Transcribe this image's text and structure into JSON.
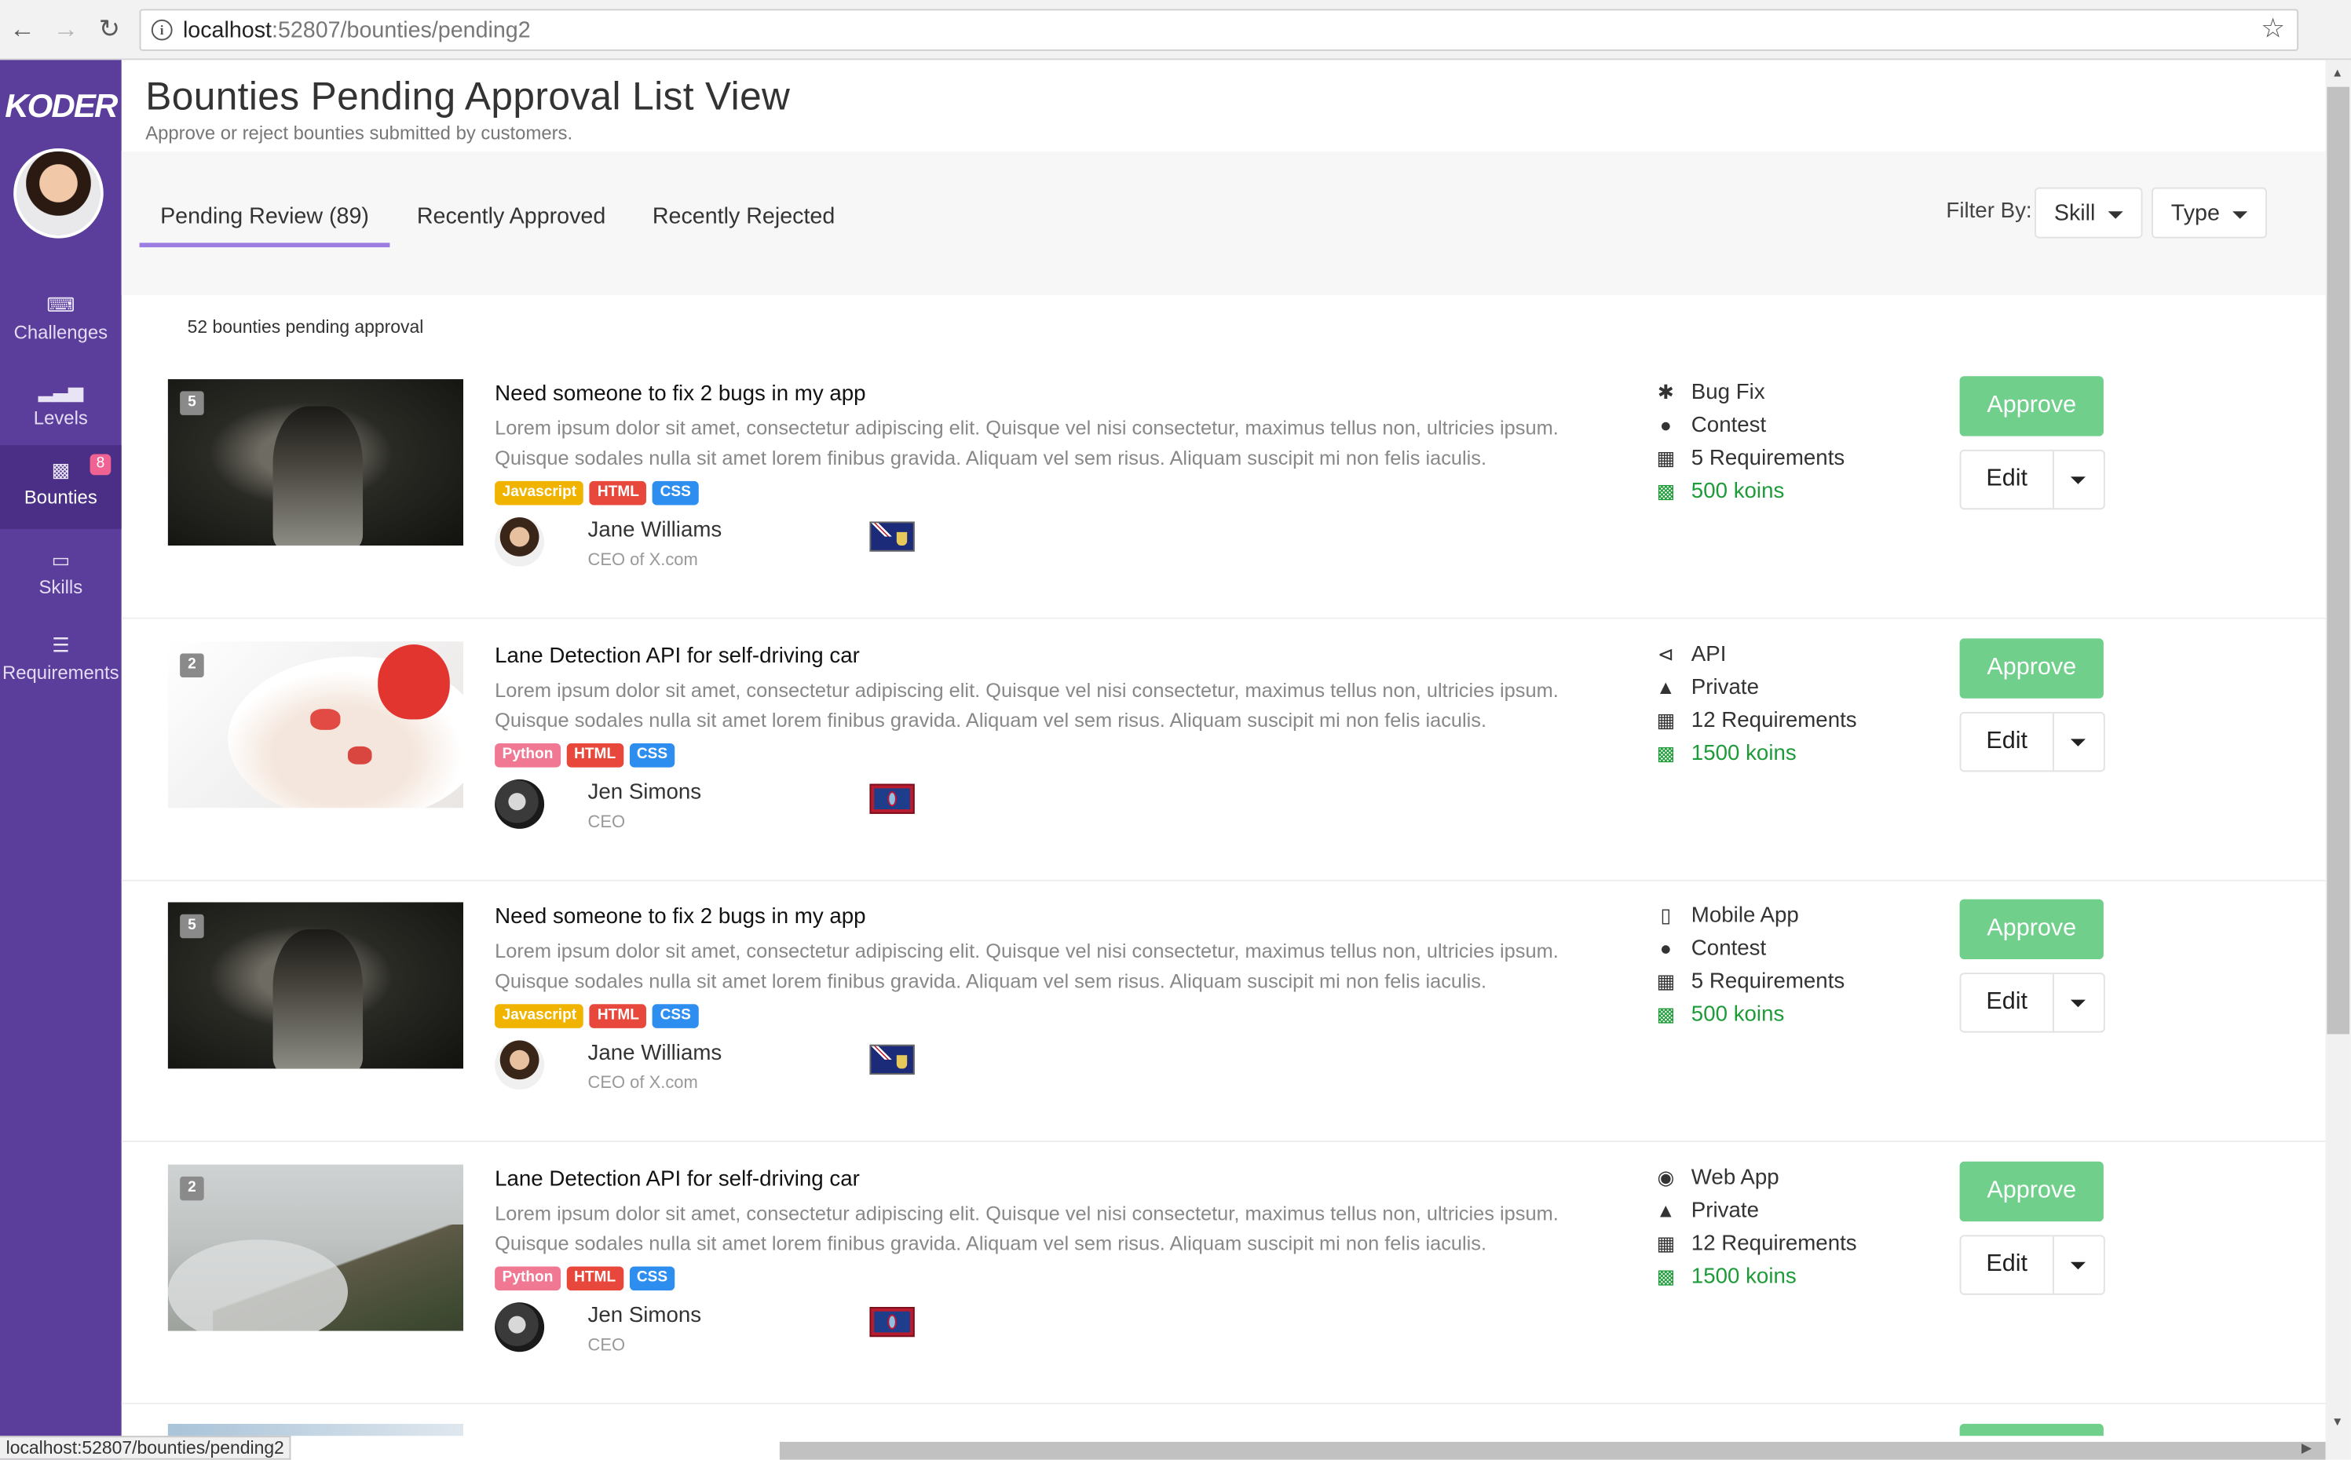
{
  "browser": {
    "url_host": "localhost",
    "url_path": ":52807/bounties/pending2"
  },
  "sidebar": {
    "logo": "KODER",
    "items": [
      {
        "label": "Challenges",
        "icon": "keyboard-icon"
      },
      {
        "label": "Levels",
        "icon": "signal-icon"
      },
      {
        "label": "Bounties",
        "icon": "money-icon",
        "badge": "8"
      },
      {
        "label": "Skills",
        "icon": "laptop-icon"
      },
      {
        "label": "Requirements",
        "icon": "list-icon"
      }
    ]
  },
  "header": {
    "title": "Bounties Pending Approval List View",
    "subtitle": "Approve or reject bounties submitted by customers."
  },
  "tabs": [
    "Pending Review (89)",
    "Recently Approved",
    "Recently Rejected"
  ],
  "filters": {
    "label": "Filter By:",
    "skill": "Skill",
    "type": "Type"
  },
  "count_text": "52 bounties pending approval",
  "colors": {
    "sidebar": "#5b3d9b",
    "approve": "#6fcf8b",
    "tab_underline": "#9c7ee3",
    "koins": "#1e9b39",
    "tag_javascript": "#f0b400",
    "tag_html": "#e8473b",
    "tag_css": "#2d8ef0",
    "tag_python": "#f07893"
  },
  "bounties": [
    {
      "badge": "5",
      "title": "Need someone to fix 2 bugs in my app",
      "desc1": "Lorem ipsum dolor sit amet, consectetur adipiscing elit. Quisque vel nisi consectetur, maximus tellus non, ultricies ipsum.",
      "desc2": "Quisque sodales nulla sit amet lorem finibus gravida. Aliquam vel sem risus. Aliquam suscipit mi non felis iaculis.",
      "tags": [
        "Javascript",
        "HTML",
        "CSS"
      ],
      "person": "Jane Williams",
      "role": "CEO of X.com",
      "meta": [
        "Bug Fix",
        "Contest",
        "5 Requirements",
        "500 koins"
      ],
      "meta_icons": [
        "bug-icon",
        "users-icon",
        "calendar-icon",
        "money-icon"
      ],
      "approve": "Approve",
      "edit": "Edit"
    },
    {
      "badge": "2",
      "title": "Lane Detection API for self-driving car",
      "desc1": "Lorem ipsum dolor sit amet, consectetur adipiscing elit. Quisque vel nisi consectetur, maximus tellus non, ultricies ipsum.",
      "desc2": "Quisque sodales nulla sit amet lorem finibus gravida. Aliquam vel sem risus. Aliquam suscipit mi non felis iaculis.",
      "tags": [
        "Python",
        "HTML",
        "CSS"
      ],
      "person": "Jen Simons",
      "role": "CEO",
      "meta": [
        "API",
        "Private",
        "12 Requirements",
        "1500 koins"
      ],
      "meta_icons": [
        "share-icon",
        "trophy-icon",
        "calendar-icon",
        "money-icon"
      ],
      "approve": "Approve",
      "edit": "Edit"
    },
    {
      "badge": "5",
      "title": "Need someone to fix 2 bugs in my app",
      "desc1": "Lorem ipsum dolor sit amet, consectetur adipiscing elit. Quisque vel nisi consectetur, maximus tellus non, ultricies ipsum.",
      "desc2": "Quisque sodales nulla sit amet lorem finibus gravida. Aliquam vel sem risus. Aliquam suscipit mi non felis iaculis.",
      "tags": [
        "Javascript",
        "HTML",
        "CSS"
      ],
      "person": "Jane Williams",
      "role": "CEO of X.com",
      "meta": [
        "Mobile App",
        "Contest",
        "5 Requirements",
        "500 koins"
      ],
      "meta_icons": [
        "mobile-icon",
        "users-icon",
        "calendar-icon",
        "money-icon"
      ],
      "approve": "Approve",
      "edit": "Edit"
    },
    {
      "badge": "2",
      "title": "Lane Detection API for self-driving car",
      "desc1": "Lorem ipsum dolor sit amet, consectetur adipiscing elit. Quisque vel nisi consectetur, maximus tellus non, ultricies ipsum.",
      "desc2": "Quisque sodales nulla sit amet lorem finibus gravida. Aliquam vel sem risus. Aliquam suscipit mi non felis iaculis.",
      "tags": [
        "Python",
        "HTML",
        "CSS"
      ],
      "person": "Jen Simons",
      "role": "CEO",
      "meta": [
        "Web App",
        "Private",
        "12 Requirements",
        "1500 koins"
      ],
      "meta_icons": [
        "globe-icon",
        "trophy-icon",
        "calendar-icon",
        "money-icon"
      ],
      "approve": "Approve",
      "edit": "Edit"
    }
  ],
  "status_url": "localhost:52807/bounties/pending2"
}
